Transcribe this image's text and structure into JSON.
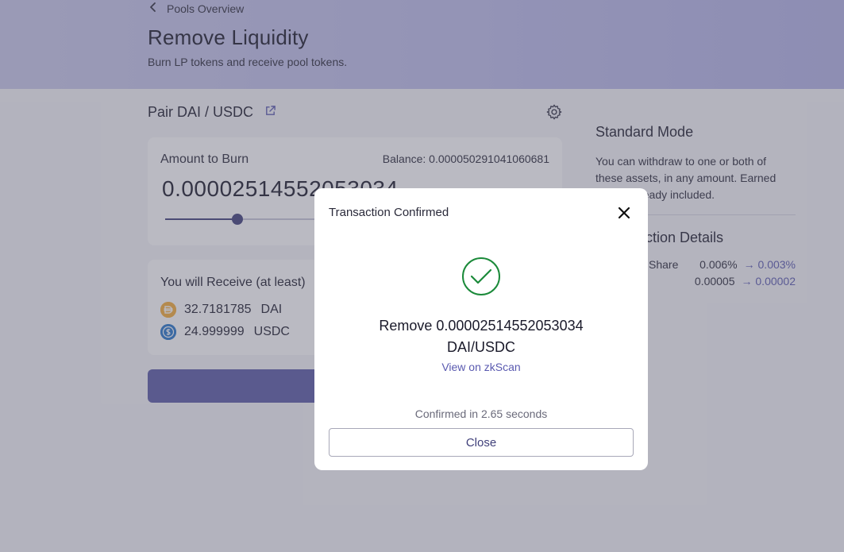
{
  "header": {
    "back_label": "Pools Overview",
    "title": "Remove Liquidity",
    "subtitle": "Burn LP tokens and receive pool tokens."
  },
  "pair": {
    "label": "Pair DAI / USDC"
  },
  "burn": {
    "label": "Amount to Burn",
    "balance": "Balance: 0.000050291041060681",
    "amount": "0.00002514552053034",
    "slider_fraction": 0.19
  },
  "receive": {
    "title": "You will Receive (at least)",
    "items": [
      {
        "amount": "32.7181785",
        "symbol": "DAI",
        "icon": "dai-token-icon"
      },
      {
        "amount": "24.999999",
        "symbol": "USDC",
        "icon": "usdc-token-icon"
      }
    ]
  },
  "side": {
    "mode_title": "Standard Mode",
    "mode_desc_line1": "You can withdraw to one or both of",
    "mode_desc_line2": "these assets, in any amount. Earned",
    "mode_desc_line3": "lready included.",
    "details_title": "ction Details",
    "share_label": "Share",
    "share_old": "0.006%",
    "share_new": "→ 0.003%",
    "lp_old": "0.00005",
    "lp_new": "→ 0.00002"
  },
  "modal": {
    "title": "Transaction Confirmed",
    "message_line1": "Remove 0.00002514552053034",
    "message_line2": "DAI/USDC",
    "link": "View on zkScan",
    "confirmed_text": "Confirmed in 2.65 seconds",
    "close_label": "Close"
  },
  "colors": {
    "accent": "#40407a",
    "link": "#5a5ab0",
    "success": "#1b8a3a",
    "dai": "#f5ac37",
    "usdc": "#2775ca"
  }
}
